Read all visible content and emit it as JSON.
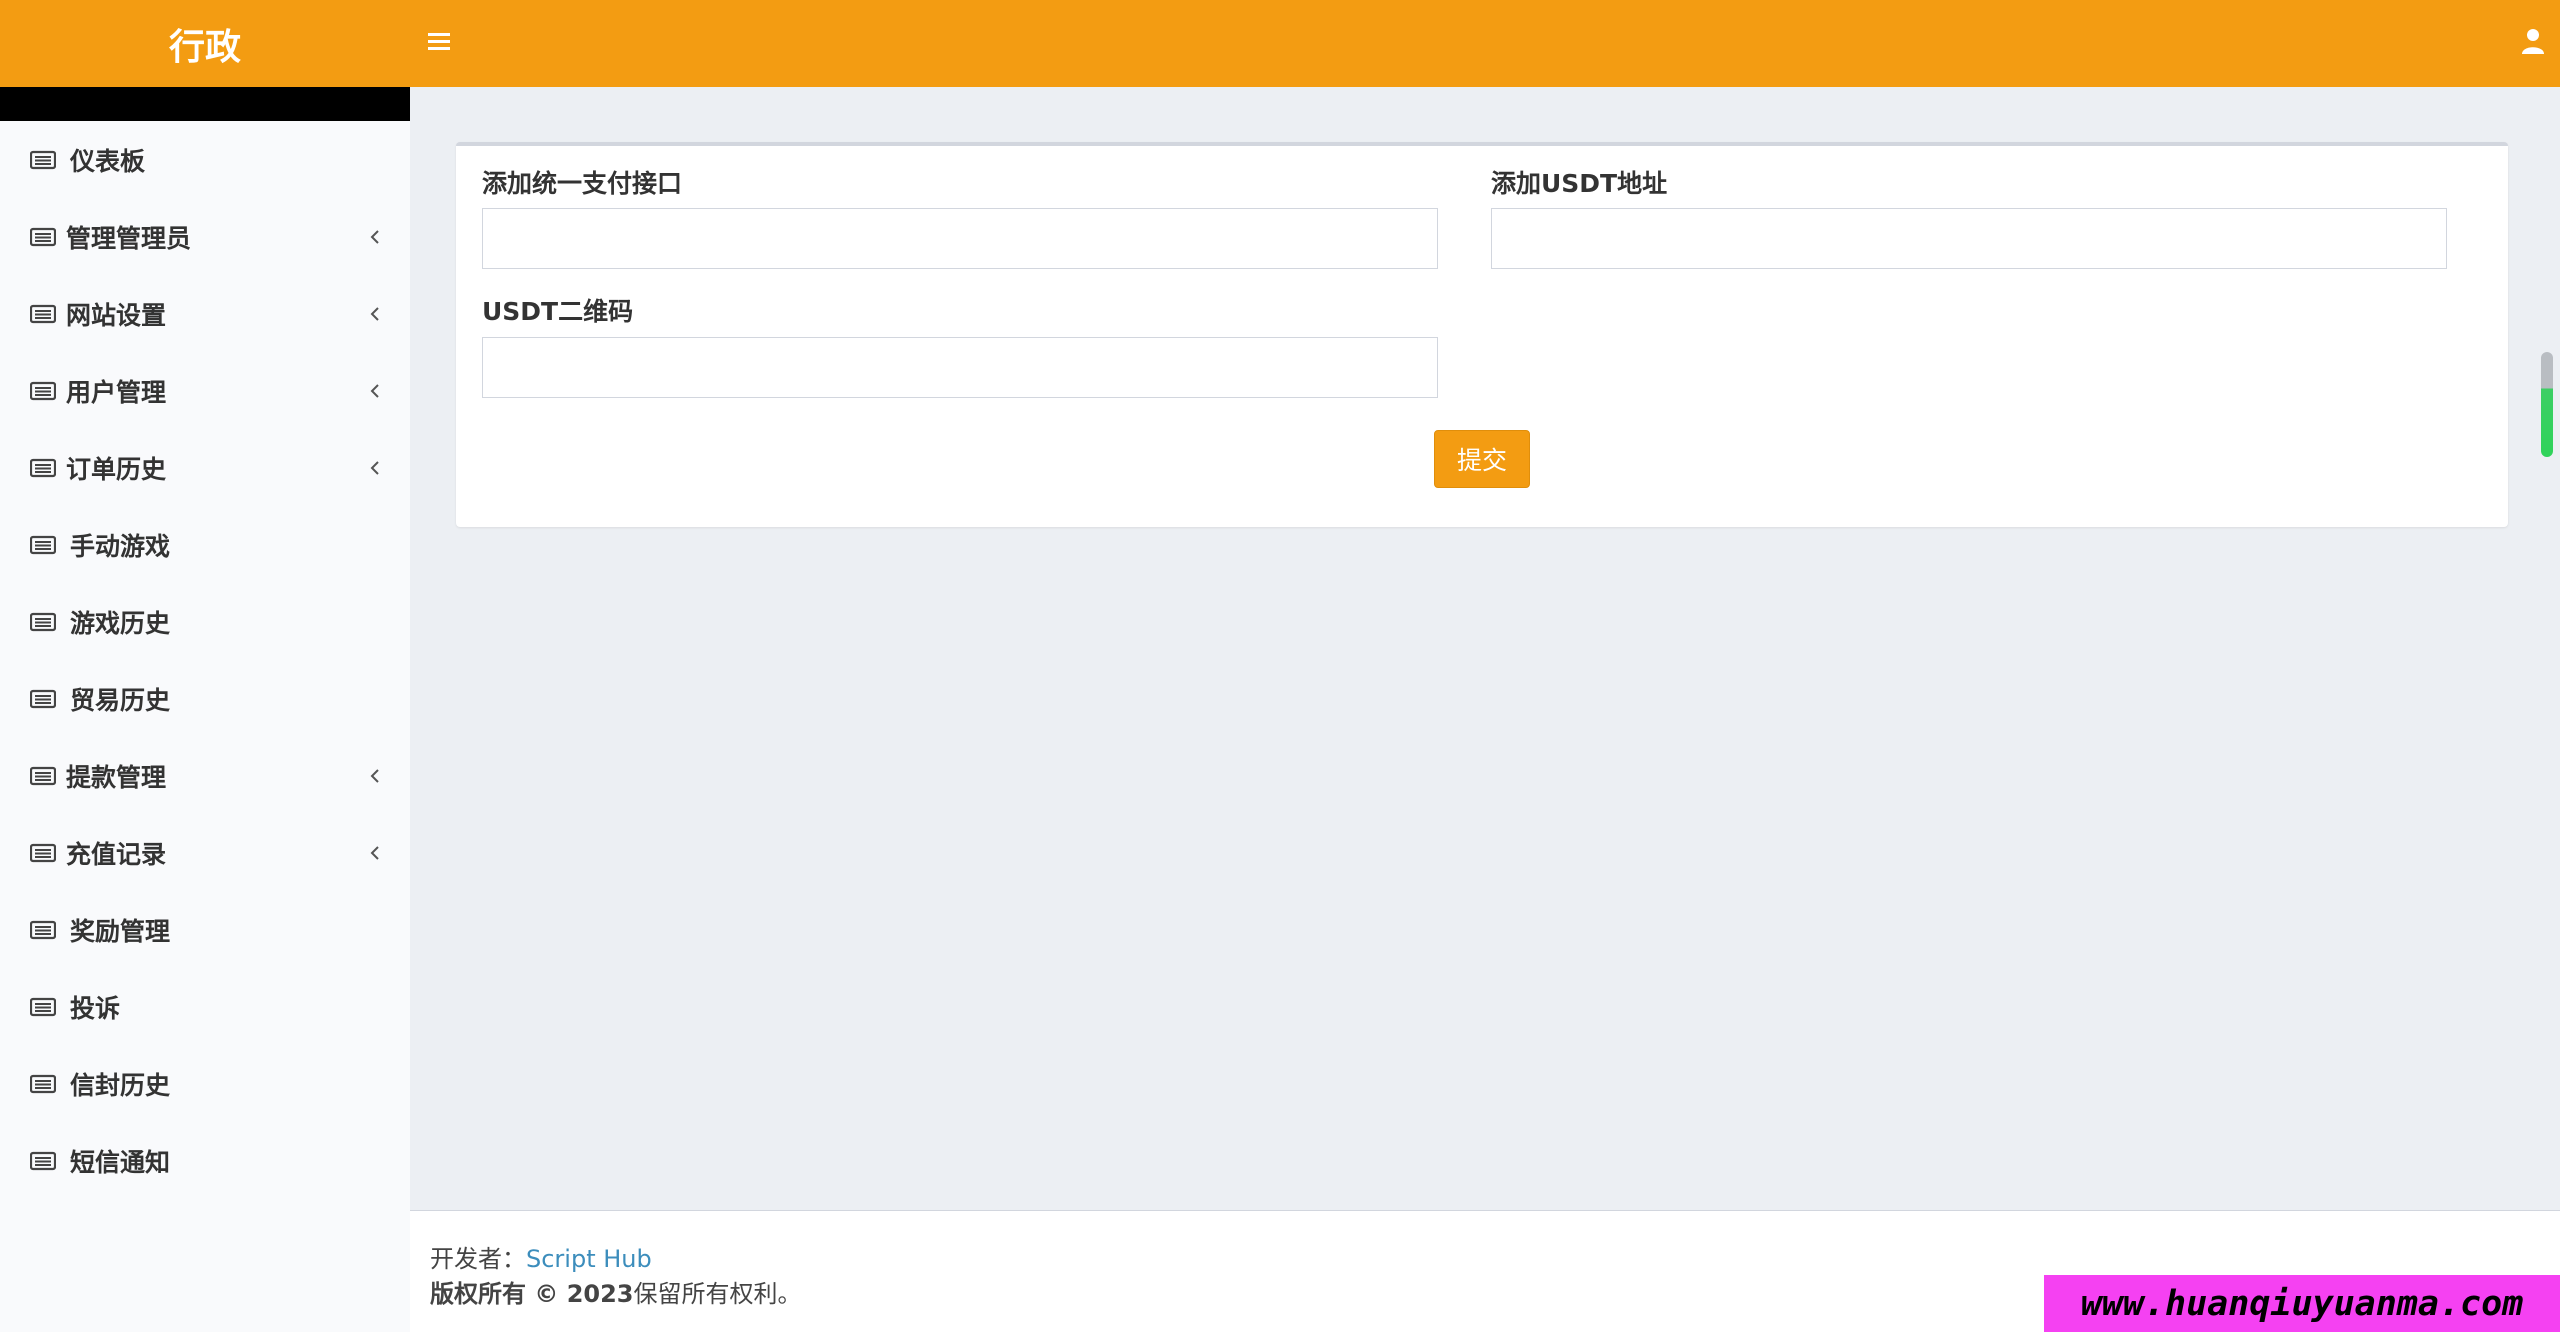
{
  "header": {
    "brand": "行政",
    "menu_icon": "hamburger-menu-icon",
    "user_icon": "user-icon",
    "color": "#f39c12"
  },
  "sidebar": {
    "items": [
      {
        "label": "仪表板",
        "has_submenu": false
      },
      {
        "label": "管理管理员",
        "has_submenu": true
      },
      {
        "label": "网站设置",
        "has_submenu": true
      },
      {
        "label": "用户管理",
        "has_submenu": true
      },
      {
        "label": "订单历史",
        "has_submenu": true
      },
      {
        "label": "手动游戏",
        "has_submenu": false
      },
      {
        "label": "游戏历史",
        "has_submenu": false
      },
      {
        "label": "贸易历史",
        "has_submenu": false
      },
      {
        "label": "提款管理",
        "has_submenu": true
      },
      {
        "label": "充值记录",
        "has_submenu": true
      },
      {
        "label": "奖励管理",
        "has_submenu": false
      },
      {
        "label": "投诉",
        "has_submenu": false
      },
      {
        "label": "信封历史",
        "has_submenu": false
      },
      {
        "label": "短信通知",
        "has_submenu": false
      }
    ],
    "item_icon": "list-icon",
    "chevron_icon": "chevron-left-icon"
  },
  "form": {
    "unified_payment_label": "添加统一支付接口",
    "unified_payment_value": "",
    "usdt_address_label": "添加USDT地址",
    "usdt_address_value": "",
    "usdt_qr_label": "USDT二维码",
    "usdt_qr_value": "",
    "submit_label": "提交"
  },
  "footer": {
    "developer_prefix": "开发者：",
    "developer_name": "Script Hub",
    "copyright_bold": "版权所有 © 2023",
    "copyright_rest": "保留所有权利。"
  },
  "watermark": "www.huanqiuyuanma.com"
}
